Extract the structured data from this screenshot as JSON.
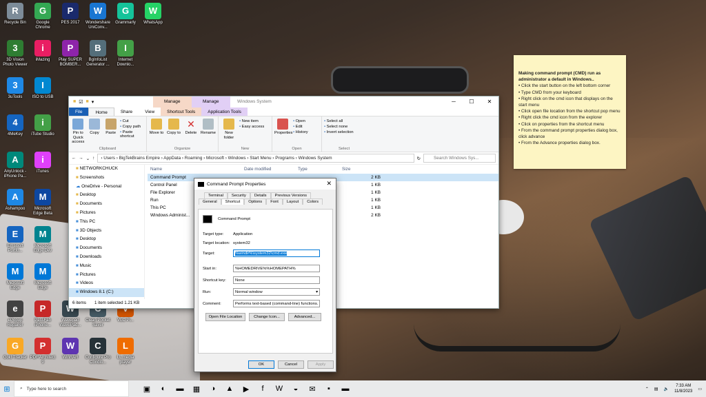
{
  "desktop_icons": [
    {
      "label": "Recycle Bin",
      "icon": "recycle-bin-icon",
      "color": "#7d8c99"
    },
    {
      "label": "Google Chrome",
      "icon": "chrome-icon",
      "color": "#34a853"
    },
    {
      "label": "PES 2017",
      "icon": "pes-icon",
      "color": "#1a2a6c"
    },
    {
      "label": "Wondershare UniConv...",
      "icon": "uniconverter-icon",
      "color": "#1976d2"
    },
    {
      "label": "Grammarly",
      "icon": "grammarly-icon",
      "color": "#15c39a"
    },
    {
      "label": "WhatsApp",
      "icon": "whatsapp-icon",
      "color": "#25d366"
    },
    {
      "label": "3D Vision Photo Viewer",
      "icon": "3dvision-icon",
      "color": "#2e7d32"
    },
    {
      "label": "iMazing",
      "icon": "imazing-icon",
      "color": "#e91e63"
    },
    {
      "label": "Play SUPER BOMBER...",
      "icon": "game-icon",
      "color": "#8e24aa"
    },
    {
      "label": "BgInfoList Generator ...",
      "icon": "list-icon",
      "color": "#546e7a"
    },
    {
      "label": "Internet Downlo...",
      "icon": "idm-icon",
      "color": "#43a047"
    },
    {
      "label": "3uTools",
      "icon": "3utools-icon",
      "color": "#1e88e5"
    },
    {
      "label": "ISO to USB",
      "icon": "usb-icon",
      "color": "#0288d1"
    },
    {
      "label": "4MeKey",
      "icon": "4mekey-icon",
      "color": "#1565c0"
    },
    {
      "label": "iTube Studio",
      "icon": "itube-icon",
      "color": "#43a047"
    },
    {
      "label": "AnyUnlock - iPhone Pa...",
      "icon": "anyunlock-icon",
      "color": "#00897b"
    },
    {
      "label": "iTunes",
      "icon": "itunes-icon",
      "color": "#e040fb"
    },
    {
      "label": "Ashampoo",
      "icon": "ashampoo-icon",
      "color": "#1e88e5"
    },
    {
      "label": "Microsoft Edge Beta",
      "icon": "edge-beta-icon",
      "color": "#0d47a1"
    },
    {
      "label": "Emsisoft Portfo...",
      "icon": "emsisoft-icon",
      "color": "#1565c0"
    },
    {
      "label": "Microsoft Edge Dev",
      "icon": "edge-dev-icon",
      "color": "#00838f"
    },
    {
      "label": "Microsoft Edge",
      "icon": "edge-icon",
      "color": "#0078d7"
    },
    {
      "label": "eScreen Control...",
      "icon": "escreen-icon",
      "color": "#1976d2"
    },
    {
      "label": "Microsoft Edge",
      "icon": "edge-icon",
      "color": "#0078d7"
    },
    {
      "label": "ePopup Repairer",
      "icon": "epopup-icon",
      "color": "#424242"
    },
    {
      "label": "PassFab iPhone...",
      "icon": "passfab-icon",
      "color": "#c62828"
    },
    {
      "label": "Wavepad WavePad...",
      "icon": "wavepad-icon",
      "color": "#37474f"
    },
    {
      "label": "Clean Pocket Saver",
      "icon": "cleaner-icon",
      "color": "#455a64"
    },
    {
      "label": "VLC Pl...",
      "icon": "vlc-icon",
      "color": "#d35400"
    },
    {
      "label": "Gold Tracker",
      "icon": "gold-icon",
      "color": "#f9a825"
    },
    {
      "label": "PDF Architect 9",
      "icon": "pdf-icon",
      "color": "#d32f2f"
    },
    {
      "label": "WinRAR",
      "icon": "winrar-icon",
      "color": "#5e35b1"
    },
    {
      "label": "Configure Pro Conditi...",
      "icon": "config-icon",
      "color": "#263238"
    },
    {
      "label": "LL media player",
      "icon": "vlc-icon",
      "color": "#ef6c00"
    }
  ],
  "sticky": {
    "title": "Making command prompt (CMD) run as administrator a default in Windows..",
    "bullets": [
      "• Click the start button on the left bottom corner",
      "• Type CMD from your keyboard",
      "• Right click on the cmd icon that displays on the start menu",
      "• Click open file location from the shortcut pop menu",
      "• Right click the cmd icon from the explorer",
      "• Click on properties from the shortcut menu",
      "• From the command prompt properties dialog box, click advance",
      "• From the Advance properties dialog box."
    ]
  },
  "explorer": {
    "ctx_manage1": "Manage",
    "ctx_manage2": "Manage",
    "window_title": "Windows System",
    "tabs": [
      "File",
      "Home",
      "Share",
      "View",
      "Shortcut Tools",
      "Application Tools"
    ],
    "clipboard": {
      "pin": "Pin to Quick access",
      "copy": "Copy",
      "paste": "Paste",
      "cut": "Cut",
      "copy_path": "Copy path",
      "paste_shortcut": "Paste shortcut",
      "group": "Clipboard"
    },
    "organize": {
      "move": "Move to",
      "copy": "Copy to",
      "delete": "Delete",
      "rename": "Rename",
      "group": "Organize"
    },
    "new_group": {
      "folder": "New folder",
      "item": "New item",
      "easy": "Easy access",
      "group": "New"
    },
    "open_group": {
      "properties": "Properties",
      "open": "Open",
      "edit": "Edit",
      "history": "History",
      "group": "Open"
    },
    "select_group": {
      "all": "Select all",
      "none": "Select none",
      "invert": "Invert selection",
      "group": "Select"
    },
    "address": "›  Users  ›  BigTekBrains Empire  ›  AppData  ›  Roaming  ›  Microsoft  ›  Windows  ›  Start Menu  ›  Programs  ›  Windows System",
    "search_placeholder": "Search Windows Sys...",
    "nav": [
      {
        "label": "NETWORKCHUCK",
        "kind": "folder"
      },
      {
        "label": "Screenshots",
        "kind": "folder"
      },
      {
        "label": "OneDrive - Personal",
        "kind": "cloud"
      },
      {
        "label": "Desktop",
        "kind": "folder"
      },
      {
        "label": "Documents",
        "kind": "folder"
      },
      {
        "label": "Pictures",
        "kind": "folder"
      },
      {
        "label": "This PC",
        "kind": "pc"
      },
      {
        "label": "3D Objects",
        "kind": "pc"
      },
      {
        "label": "Desktop",
        "kind": "pc"
      },
      {
        "label": "Documents",
        "kind": "pc"
      },
      {
        "label": "Downloads",
        "kind": "pc"
      },
      {
        "label": "Music",
        "kind": "pc"
      },
      {
        "label": "Pictures",
        "kind": "pc"
      },
      {
        "label": "Videos",
        "kind": "pc"
      },
      {
        "label": "Windows 8.1 (C:)",
        "kind": "drive"
      }
    ],
    "columns": [
      "Name",
      "Date modified",
      "Type",
      "Size"
    ],
    "files": [
      {
        "name": "Command Prompt",
        "size": "2 KB",
        "selected": true
      },
      {
        "name": "Control Panel",
        "size": "1 KB",
        "selected": false
      },
      {
        "name": "File Explorer",
        "size": "1 KB",
        "selected": false
      },
      {
        "name": "Run",
        "size": "1 KB",
        "selected": false
      },
      {
        "name": "This PC",
        "size": "1 KB",
        "selected": false
      },
      {
        "name": "Windows Administ...",
        "size": "2 KB",
        "selected": false
      }
    ],
    "status_items": "6 items",
    "status_selected": "1 item selected  1.21 KB"
  },
  "dialog": {
    "title": "Command Prompt Properties",
    "tabs_row1": [
      "Terminal",
      "Security",
      "Details",
      "Previous Versions"
    ],
    "tabs_row2": [
      "General",
      "Shortcut",
      "Options",
      "Font",
      "Layout",
      "Colors"
    ],
    "name": "Command Prompt",
    "target_type_label": "Target type:",
    "target_type": "Application",
    "target_location_label": "Target location:",
    "target_location": "system32",
    "target_label": "Target:",
    "target": "%windir%\\system32\\cmd.exe",
    "start_in_label": "Start in:",
    "start_in": "%HOMEDRIVE%%HOMEPATH%",
    "shortcut_key_label": "Shortcut key:",
    "shortcut_key": "None",
    "run_label": "Run:",
    "run": "Normal window",
    "comment_label": "Comment:",
    "comment": "Performs text-based (command-line) functions.",
    "open_location": "Open File Location",
    "change_icon": "Change Icon...",
    "advanced": "Advanced...",
    "ok": "OK",
    "cancel": "Cancel",
    "apply": "Apply"
  },
  "taskbar": {
    "search_placeholder": "Type here to search",
    "time": "7:33 AM",
    "date": "11/8/2023",
    "apps": [
      "task-view-icon",
      "edge-icon",
      "file-explorer-icon",
      "calculator-icon",
      "edge-dev-icon",
      "hat-icon",
      "youtube-icon",
      "facebook-icon",
      "word-icon",
      "edge-beta-icon",
      "chat-icon",
      "sticky-notes-icon",
      "explorer-active-icon"
    ]
  }
}
